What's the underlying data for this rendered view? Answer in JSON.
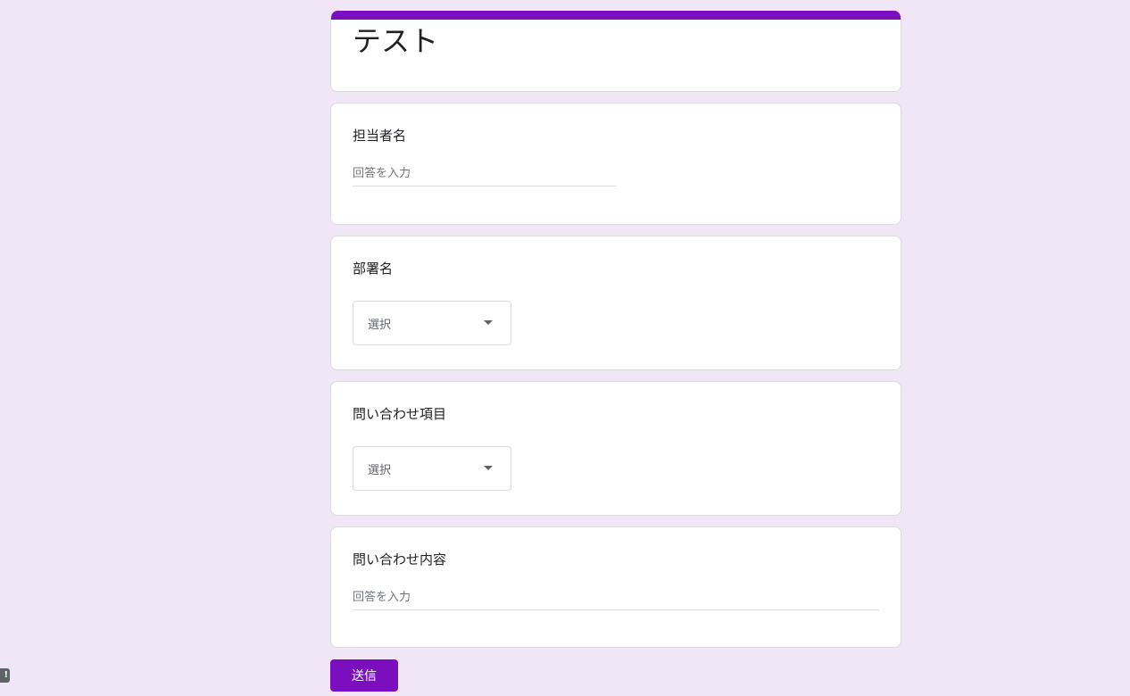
{
  "form": {
    "title": "テスト",
    "accent_color": "#7b0fbf",
    "background_color": "#f0e6f6"
  },
  "questions": [
    {
      "label": "担当者名",
      "type": "short_text",
      "placeholder": "回答を入力"
    },
    {
      "label": "部署名",
      "type": "dropdown",
      "selected": "選択"
    },
    {
      "label": "問い合わせ項目",
      "type": "dropdown",
      "selected": "選択"
    },
    {
      "label": "問い合わせ内容",
      "type": "paragraph",
      "placeholder": "回答を入力"
    }
  ],
  "submit": {
    "label": "送信"
  },
  "corner_badge": {
    "text": "!"
  }
}
